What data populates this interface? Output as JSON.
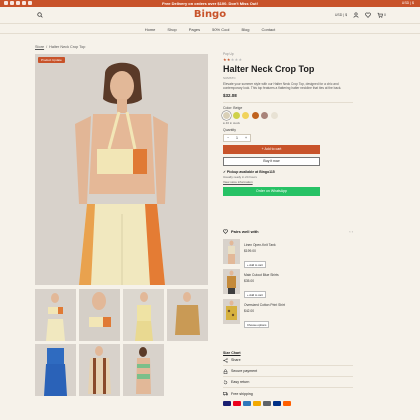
{
  "topbar": {
    "promo": "Free Delivery on orders over $100. Don't Miss Out!",
    "currency": "USD | $"
  },
  "header": {
    "logo": "Bingo",
    "currency_icon": "globe-icon",
    "cart_count": "0"
  },
  "nav": {
    "items": [
      {
        "label": "Home"
      },
      {
        "label": "Shop"
      },
      {
        "label": "Pages"
      },
      {
        "label": "50% Cool"
      },
      {
        "label": "Blog"
      },
      {
        "label": "Contact"
      }
    ]
  },
  "breadcrumb": {
    "home": "Store",
    "current": "Halter Neck Crop Top"
  },
  "product": {
    "badge": "Product Update",
    "vendor": "Pop Up",
    "rating_full": "★★",
    "rating_empty": "★★★",
    "title": "Halter Neck Crop Top",
    "sku": "SUMSTC",
    "description": "Elevate your summer style with our Halter Neck Crop Top, designed for a chic and contemporary look. This top features a flattering halter neckline that ties at the back.",
    "price": "$32.08",
    "color_label": "Color: Beige",
    "colors": [
      "#d9d0b8",
      "#cfd14a",
      "#f1d35c",
      "#c0621e",
      "#a9847a",
      "#e8e2d4"
    ],
    "stock": "● 46 in stock",
    "quantity_label": "Quantity",
    "quantity": "1",
    "add_to_cart": "+ Add to cart",
    "buy_now": "Buy it now",
    "pickup_title": "✓ Pickup available at Bingo115",
    "pickup_sub": "Usually ready in 24 hours",
    "store_info": "View store information",
    "whatsapp": "Order on WhatsApp"
  },
  "pairs": {
    "title": "Pairs well with",
    "items": [
      {
        "name": "Linen Open-Knit Tank",
        "price": "$199.00",
        "button": "+ Add to cart"
      },
      {
        "name": "Main Cutout Blue Shirts",
        "price": "$35.00",
        "button": "+ Add to cart"
      },
      {
        "name": "Oversized Cotton Print Shirt",
        "price": "$42.00",
        "button": "Choose options"
      }
    ]
  },
  "features": {
    "size_chart": "Size Chart",
    "items": [
      {
        "label": "Share",
        "icon": "share-icon"
      },
      {
        "label": "Secure payment",
        "icon": "lock-icon"
      },
      {
        "label": "Easy return",
        "icon": "return-icon"
      },
      {
        "label": "Free shipping",
        "icon": "truck-icon"
      }
    ],
    "payment_colors": [
      "#1a1f71",
      "#eb001b",
      "#2e77bc",
      "#f2a900",
      "#5f6368",
      "#003087",
      "#ff5f00"
    ]
  }
}
